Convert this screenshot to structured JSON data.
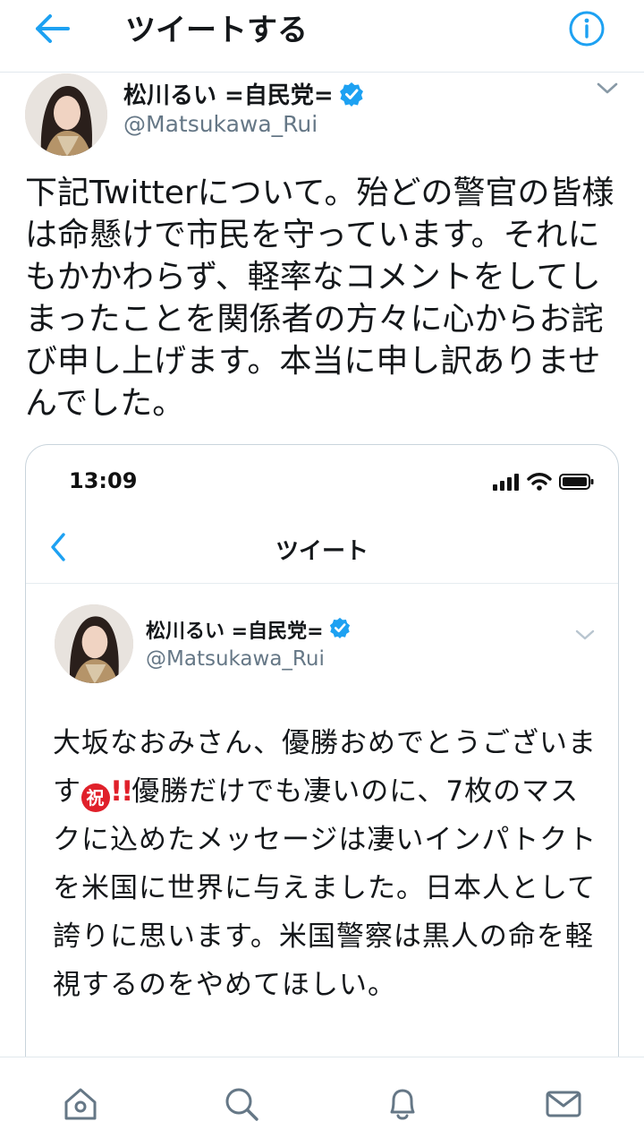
{
  "header": {
    "title": "ツイートする",
    "back_icon": "back-arrow-icon",
    "info_icon": "info-icon"
  },
  "tweet": {
    "author_name": "松川るい =自民党=",
    "handle": "@Matsukawa_Rui",
    "text": "下記Twitterについて。殆どの警官の皆様は命懸けで市民を守っています。それにもかかわらず、軽率なコメントをしてしまったことを関係者の方々に心からお詫び申し上げます。本当に申し訳ありませんでした。"
  },
  "embedded_screenshot": {
    "status_time": "13:09",
    "nav_title": "ツイート",
    "author_name": "松川るい =自民党=",
    "handle": "@Matsukawa_Rui",
    "text_before_emoji": "大坂なおみさん、優勝おめでとうございます",
    "emoji_iwai": "祝",
    "emoji_bang": "!!",
    "text_after_emoji": "優勝だけでも凄いのに、7枚のマスクに込めたメッセージは凄いインパトクトを米国に世界に与えました。日本人として誇りに思います。米国警察は黒人の命を軽視するのをやめてほしい。"
  },
  "bottom_nav": {
    "items": [
      "home-icon",
      "search-icon",
      "notifications-icon",
      "messages-icon"
    ]
  },
  "colors": {
    "accent": "#1da1f2",
    "verified": "#1da1f2",
    "secondary_text": "#657786",
    "divider": "#e1e8ed",
    "emoji_red": "#e0202a"
  }
}
